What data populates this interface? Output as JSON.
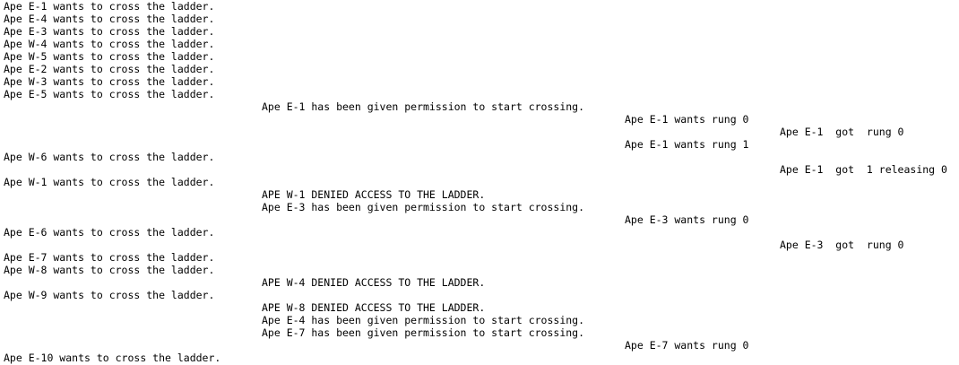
{
  "terminal": {
    "text_color": "#000000",
    "background_color": "#ffffff",
    "lines": [
      {
        "column": 0,
        "text": "Ape E-1 wants to cross the ladder."
      },
      {
        "column": 0,
        "text": "Ape E-4 wants to cross the ladder."
      },
      {
        "column": 0,
        "text": "Ape E-3 wants to cross the ladder."
      },
      {
        "column": 0,
        "text": "Ape W-4 wants to cross the ladder."
      },
      {
        "column": 0,
        "text": "Ape W-5 wants to cross the ladder."
      },
      {
        "column": 0,
        "text": "Ape E-2 wants to cross the ladder."
      },
      {
        "column": 0,
        "text": "Ape W-3 wants to cross the ladder."
      },
      {
        "column": 0,
        "text": "Ape E-5 wants to cross the ladder."
      },
      {
        "column": 1,
        "text": "Ape E-1 has been given permission to start crossing."
      },
      {
        "column": 2,
        "text": "Ape E-1 wants rung 0"
      },
      {
        "column": 3,
        "text": "Ape E-1  got  rung 0"
      },
      {
        "column": 2,
        "text": "Ape E-1 wants rung 1"
      },
      {
        "column": 0,
        "text": "Ape W-6 wants to cross the ladder."
      },
      {
        "column": 3,
        "text": "Ape E-1  got  1 releasing 0"
      },
      {
        "column": 0,
        "text": "Ape W-1 wants to cross the ladder."
      },
      {
        "column": 1,
        "text": "APE W-1 DENIED ACCESS TO THE LADDER."
      },
      {
        "column": 1,
        "text": "Ape E-3 has been given permission to start crossing."
      },
      {
        "column": 2,
        "text": "Ape E-3 wants rung 0"
      },
      {
        "column": 0,
        "text": "Ape E-6 wants to cross the ladder."
      },
      {
        "column": 3,
        "text": "Ape E-3  got  rung 0"
      },
      {
        "column": 0,
        "text": "Ape E-7 wants to cross the ladder."
      },
      {
        "column": 0,
        "text": "Ape W-8 wants to cross the ladder."
      },
      {
        "column": 1,
        "text": "APE W-4 DENIED ACCESS TO THE LADDER."
      },
      {
        "column": 0,
        "text": "Ape W-9 wants to cross the ladder."
      },
      {
        "column": 1,
        "text": "APE W-8 DENIED ACCESS TO THE LADDER."
      },
      {
        "column": 1,
        "text": "Ape E-4 has been given permission to start crossing."
      },
      {
        "column": 1,
        "text": "Ape E-7 has been given permission to start crossing."
      },
      {
        "column": 2,
        "text": "Ape E-7 wants rung 0"
      },
      {
        "column": 0,
        "text": "Ape E-10 wants to cross the ladder."
      }
    ]
  }
}
